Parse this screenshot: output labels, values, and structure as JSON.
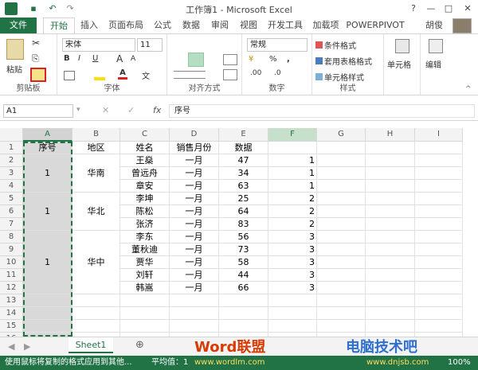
{
  "title": "工作簿1 - Microsoft Excel",
  "window": {
    "help": "?",
    "min": "—",
    "max": "□",
    "close": "✕"
  },
  "tabs": [
    "文件",
    "开始",
    "插入",
    "页面布局",
    "公式",
    "数据",
    "审阅",
    "视图",
    "开发工具",
    "加载项",
    "POWERPIVOT"
  ],
  "user": "胡俊",
  "ribbon": {
    "paste": "粘贴",
    "clipboard": "剪贴板",
    "font_name": "宋体",
    "font_size": "11",
    "font": "字体",
    "bold": "B",
    "italic": "I",
    "underline": "U",
    "fontA": "A",
    "grow": "A",
    "shrink": "A",
    "wen": "文",
    "align": "对齐方式",
    "number_format": "常规",
    "currency": "¥",
    "percent": "%",
    "comma": ",",
    "dec_inc": ".00",
    "dec_dec": ".0",
    "number": "数字",
    "cond_fmt": "条件格式",
    "table_fmt": "套用表格格式",
    "cell_style": "单元格样式",
    "styles": "样式",
    "cells": "单元格",
    "edit": "编辑"
  },
  "name_box": "A1",
  "fx": "fx",
  "formula": "序号",
  "columns": [
    "A",
    "B",
    "C",
    "D",
    "E",
    "F",
    "G",
    "H",
    "I"
  ],
  "rows": [
    "1",
    "2",
    "3",
    "4",
    "5",
    "6",
    "7",
    "8",
    "9",
    "10",
    "11",
    "12",
    "13",
    "14",
    "15",
    "16"
  ],
  "header_row": [
    "序号",
    "地区",
    "姓名",
    "销售月份",
    "数据"
  ],
  "merged": [
    {
      "no": "1",
      "region": "华南"
    },
    {
      "no": "1",
      "region": "华北"
    },
    {
      "no": "1",
      "region": "华中"
    }
  ],
  "data": [
    {
      "name": "王燊",
      "month": "一月",
      "val": "47",
      "f": "1"
    },
    {
      "name": "曾远舟",
      "month": "一月",
      "val": "34",
      "f": "1"
    },
    {
      "name": "章安",
      "month": "一月",
      "val": "63",
      "f": "1"
    },
    {
      "name": "李坤",
      "month": "一月",
      "val": "25",
      "f": "2"
    },
    {
      "name": "陈松",
      "month": "一月",
      "val": "64",
      "f": "2"
    },
    {
      "name": "张济",
      "month": "一月",
      "val": "83",
      "f": "2"
    },
    {
      "name": "李东",
      "month": "一月",
      "val": "56",
      "f": "3"
    },
    {
      "name": "董秋迪",
      "month": "一月",
      "val": "73",
      "f": "3"
    },
    {
      "name": "贾华",
      "month": "一月",
      "val": "58",
      "f": "3"
    },
    {
      "name": "刘轩",
      "month": "一月",
      "val": "44",
      "f": "3"
    },
    {
      "name": "韩嵩",
      "month": "一月",
      "val": "66",
      "f": "3"
    }
  ],
  "sheet_tab": "Sheet1",
  "add_sheet": "⊕",
  "status": "使用鼠标将复制的格式应用到其他...",
  "avg": "平均值：1",
  "wm1": "Word联盟",
  "wm2": "www.wordlm.com",
  "wm3": "电脑技术吧",
  "wm4": "www.dnjsb.com",
  "zoom": "100%"
}
